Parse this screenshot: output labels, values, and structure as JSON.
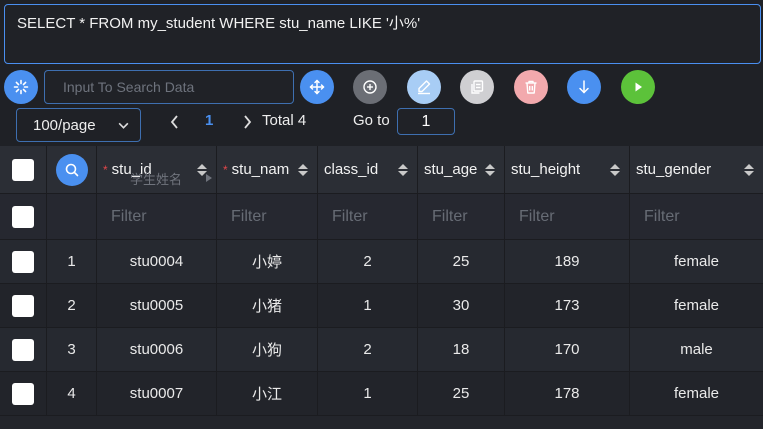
{
  "query": {
    "sql": "SELECT * FROM my_student WHERE stu_name LIKE '小%'"
  },
  "toolbar": {
    "search_placeholder": "Input To Search Data",
    "buttons": [
      {
        "name": "refresh-icon",
        "color": "#4a90f0"
      },
      {
        "name": "move-icon",
        "color": "#4a90f0"
      },
      {
        "name": "add-icon",
        "color": "#6b6e75"
      },
      {
        "name": "edit-icon",
        "color": "#a8cdf5"
      },
      {
        "name": "copy-icon",
        "color": "#cfcfd2"
      },
      {
        "name": "delete-icon",
        "color": "#f2a9ad"
      },
      {
        "name": "download-icon",
        "color": "#4a90f0"
      },
      {
        "name": "run-icon",
        "color": "#5cc23a"
      }
    ]
  },
  "pagination": {
    "page_size": "100/page",
    "current_page": "1",
    "total": "Total 4",
    "goto_label": "Go to",
    "goto_value": "1"
  },
  "table": {
    "columns": [
      {
        "label": "stu_id",
        "required": true
      },
      {
        "label": "stu_name",
        "required": true
      },
      {
        "label": "class_id",
        "required": false
      },
      {
        "label": "stu_age",
        "required": false
      },
      {
        "label": "stu_height",
        "required": false
      },
      {
        "label": "stu_gender",
        "required": false
      }
    ],
    "tooltip": "学生姓名",
    "filter_placeholder": "Filter",
    "rows": [
      {
        "index": "1",
        "stu_id": "stu0004",
        "stu_name": "小婷",
        "class_id": "2",
        "stu_age": "25",
        "stu_height": "189",
        "stu_gender": "female"
      },
      {
        "index": "2",
        "stu_id": "stu0005",
        "stu_name": "小猪",
        "class_id": "1",
        "stu_age": "30",
        "stu_height": "173",
        "stu_gender": "female"
      },
      {
        "index": "3",
        "stu_id": "stu0006",
        "stu_name": "小狗",
        "class_id": "2",
        "stu_age": "18",
        "stu_height": "170",
        "stu_gender": "male"
      },
      {
        "index": "4",
        "stu_id": "stu0007",
        "stu_name": "小江",
        "class_id": "1",
        "stu_age": "25",
        "stu_height": "178",
        "stu_gender": "female"
      }
    ]
  }
}
